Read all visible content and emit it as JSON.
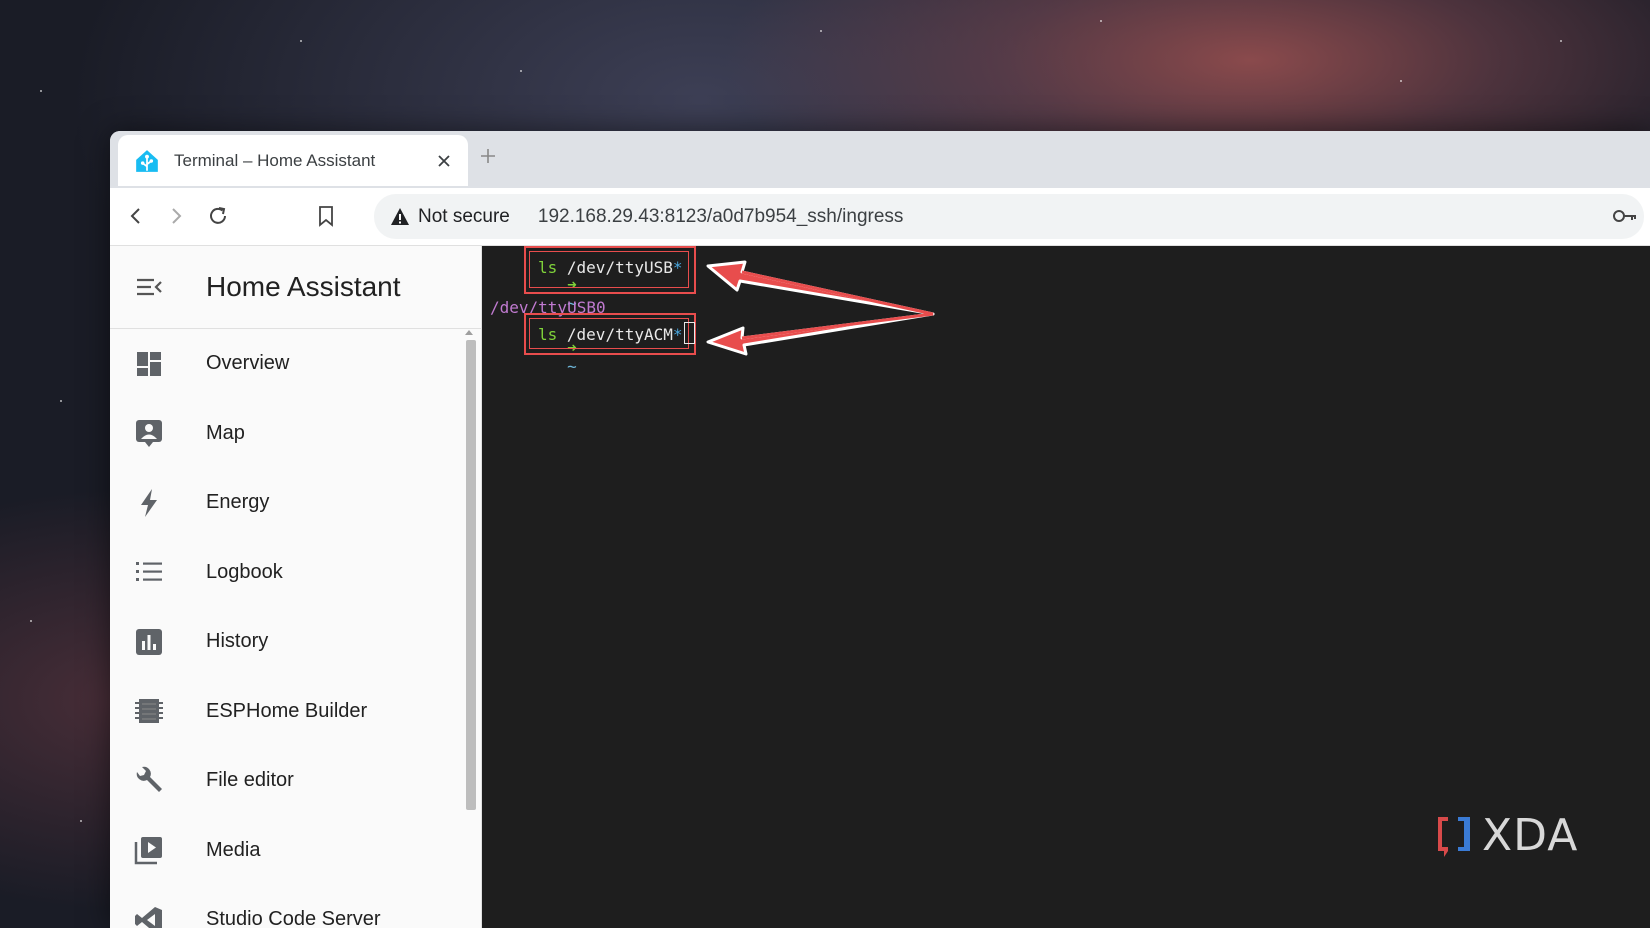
{
  "browser": {
    "tab": {
      "title": "Terminal – Home Assistant"
    },
    "address": {
      "security_label": "Not secure",
      "url": "192.168.29.43:8123/a0d7b954_ssh/ingress"
    }
  },
  "sidebar": {
    "title": "Home Assistant",
    "items": [
      {
        "label": "Overview",
        "icon": "overview-icon"
      },
      {
        "label": "Map",
        "icon": "map-icon"
      },
      {
        "label": "Energy",
        "icon": "energy-icon"
      },
      {
        "label": "Logbook",
        "icon": "logbook-icon"
      },
      {
        "label": "History",
        "icon": "history-icon"
      },
      {
        "label": "ESPHome Builder",
        "icon": "esphome-icon"
      },
      {
        "label": "File editor",
        "icon": "wrench-icon"
      },
      {
        "label": "Media",
        "icon": "media-icon"
      },
      {
        "label": "Studio Code Server",
        "icon": "vscode-icon"
      }
    ]
  },
  "terminal": {
    "prompt": "➜",
    "tilde": "~",
    "cmd1": {
      "ls": "ls",
      "path": "/dev/ttyUSB",
      "glob": "*"
    },
    "output1": "/dev/ttyUSB0",
    "cmd2": {
      "ls": "ls",
      "path": "/dev/ttyACM",
      "glob": "*"
    }
  },
  "watermark": {
    "text": "XDA"
  },
  "colors": {
    "annotation": "#e84d4d",
    "prompt_green": "#7fd23a",
    "output_purple": "#c07ad0",
    "ha_blue": "#18bcf2"
  }
}
